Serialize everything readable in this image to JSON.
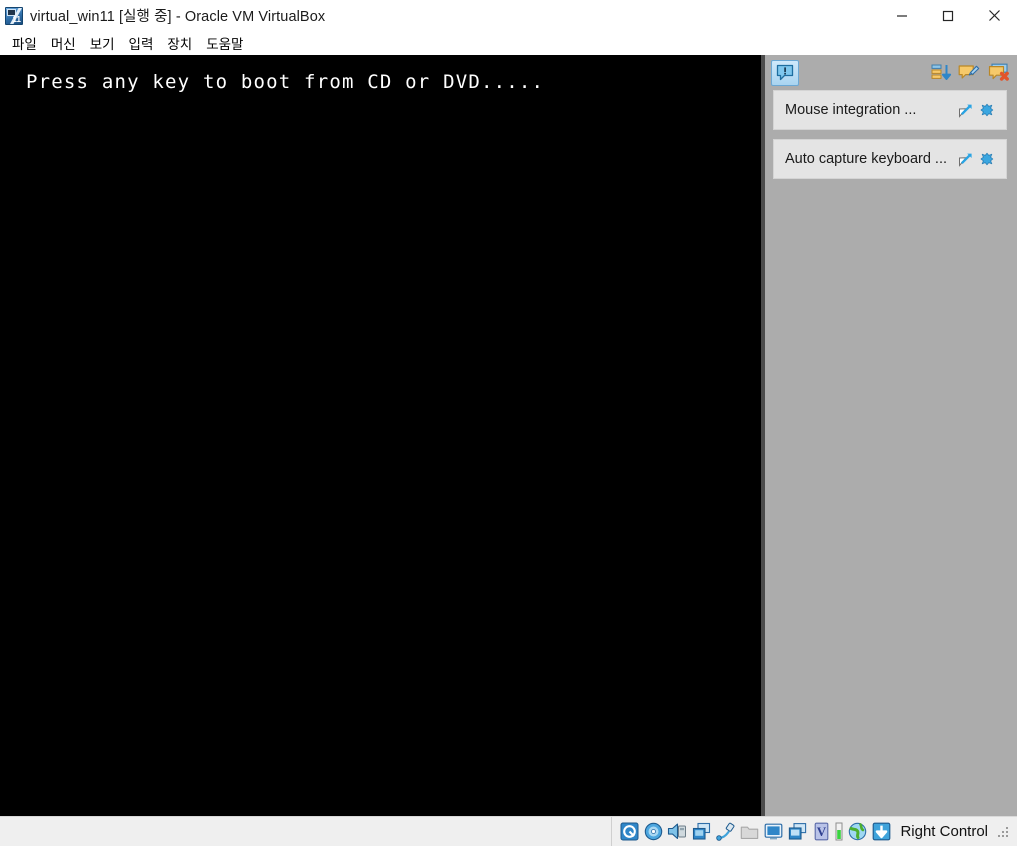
{
  "window": {
    "title": "virtual_win11 [실행 중] - Oracle VM VirtualBox",
    "icon": "virtualbox-vm-icon",
    "icon_badge": "11",
    "controls": [
      {
        "name": "minimize-button",
        "label": "—",
        "icon": "minimize-icon"
      },
      {
        "name": "maximize-button",
        "label": "□",
        "icon": "maximize-icon"
      },
      {
        "name": "close-button",
        "label": "✕",
        "icon": "close-icon"
      }
    ]
  },
  "menubar": {
    "items": [
      {
        "label": "파일",
        "name": "menu-file"
      },
      {
        "label": "머신",
        "name": "menu-machine"
      },
      {
        "label": "보기",
        "name": "menu-view"
      },
      {
        "label": "입력",
        "name": "menu-input"
      },
      {
        "label": "장치",
        "name": "menu-devices"
      },
      {
        "label": "도움말",
        "name": "menu-help"
      }
    ]
  },
  "vm_screen": {
    "boot_message": "Press any key to boot from CD or DVD.....",
    "background_color": "#000000",
    "text_color": "#ffffff"
  },
  "notifications": {
    "panel_background": "#acacac",
    "badge_icon": "notification-bubble-icon",
    "toolbar": [
      {
        "name": "sort-notifications-icon",
        "icon": "list-sort-down-icon"
      },
      {
        "name": "keep-notifications-icon",
        "icon": "pinned-note-icon"
      },
      {
        "name": "close-all-notifications-icon",
        "icon": "close-all-notes-icon"
      }
    ],
    "items": [
      {
        "label": "Mouse integration ...",
        "name": "notification-mouse-integration",
        "detach_icon": "open-external-icon",
        "close_icon": "close-notification-icon"
      },
      {
        "label": "Auto capture keyboard ...",
        "name": "notification-auto-capture-keyboard",
        "detach_icon": "open-external-icon",
        "close_icon": "close-notification-icon"
      }
    ]
  },
  "statusbar": {
    "host_key": "Right Control",
    "indicators": [
      {
        "name": "hard-disk-indicator",
        "icon": "hard-disk-icon"
      },
      {
        "name": "optical-drive-indicator",
        "icon": "optical-disk-icon"
      },
      {
        "name": "audio-indicator",
        "icon": "audio-speaker-icon"
      },
      {
        "name": "network-indicator",
        "icon": "network-icon"
      },
      {
        "name": "usb-indicator",
        "icon": "usb-plug-icon"
      },
      {
        "name": "shared-folders-indicator",
        "icon": "folder-icon"
      },
      {
        "name": "display-indicator",
        "icon": "monitor-icon"
      },
      {
        "name": "recording-indicator",
        "icon": "recording-screens-icon"
      },
      {
        "name": "features-indicator",
        "icon": "virtualization-v-icon"
      },
      {
        "name": "activity-led",
        "icon": "green-activity-led"
      },
      {
        "name": "mouse-integration-indicator",
        "icon": "mouse-globe-icon"
      },
      {
        "name": "host-key-indicator",
        "icon": "host-key-down-arrow-icon"
      }
    ],
    "resize_grip": "resize-grip"
  }
}
